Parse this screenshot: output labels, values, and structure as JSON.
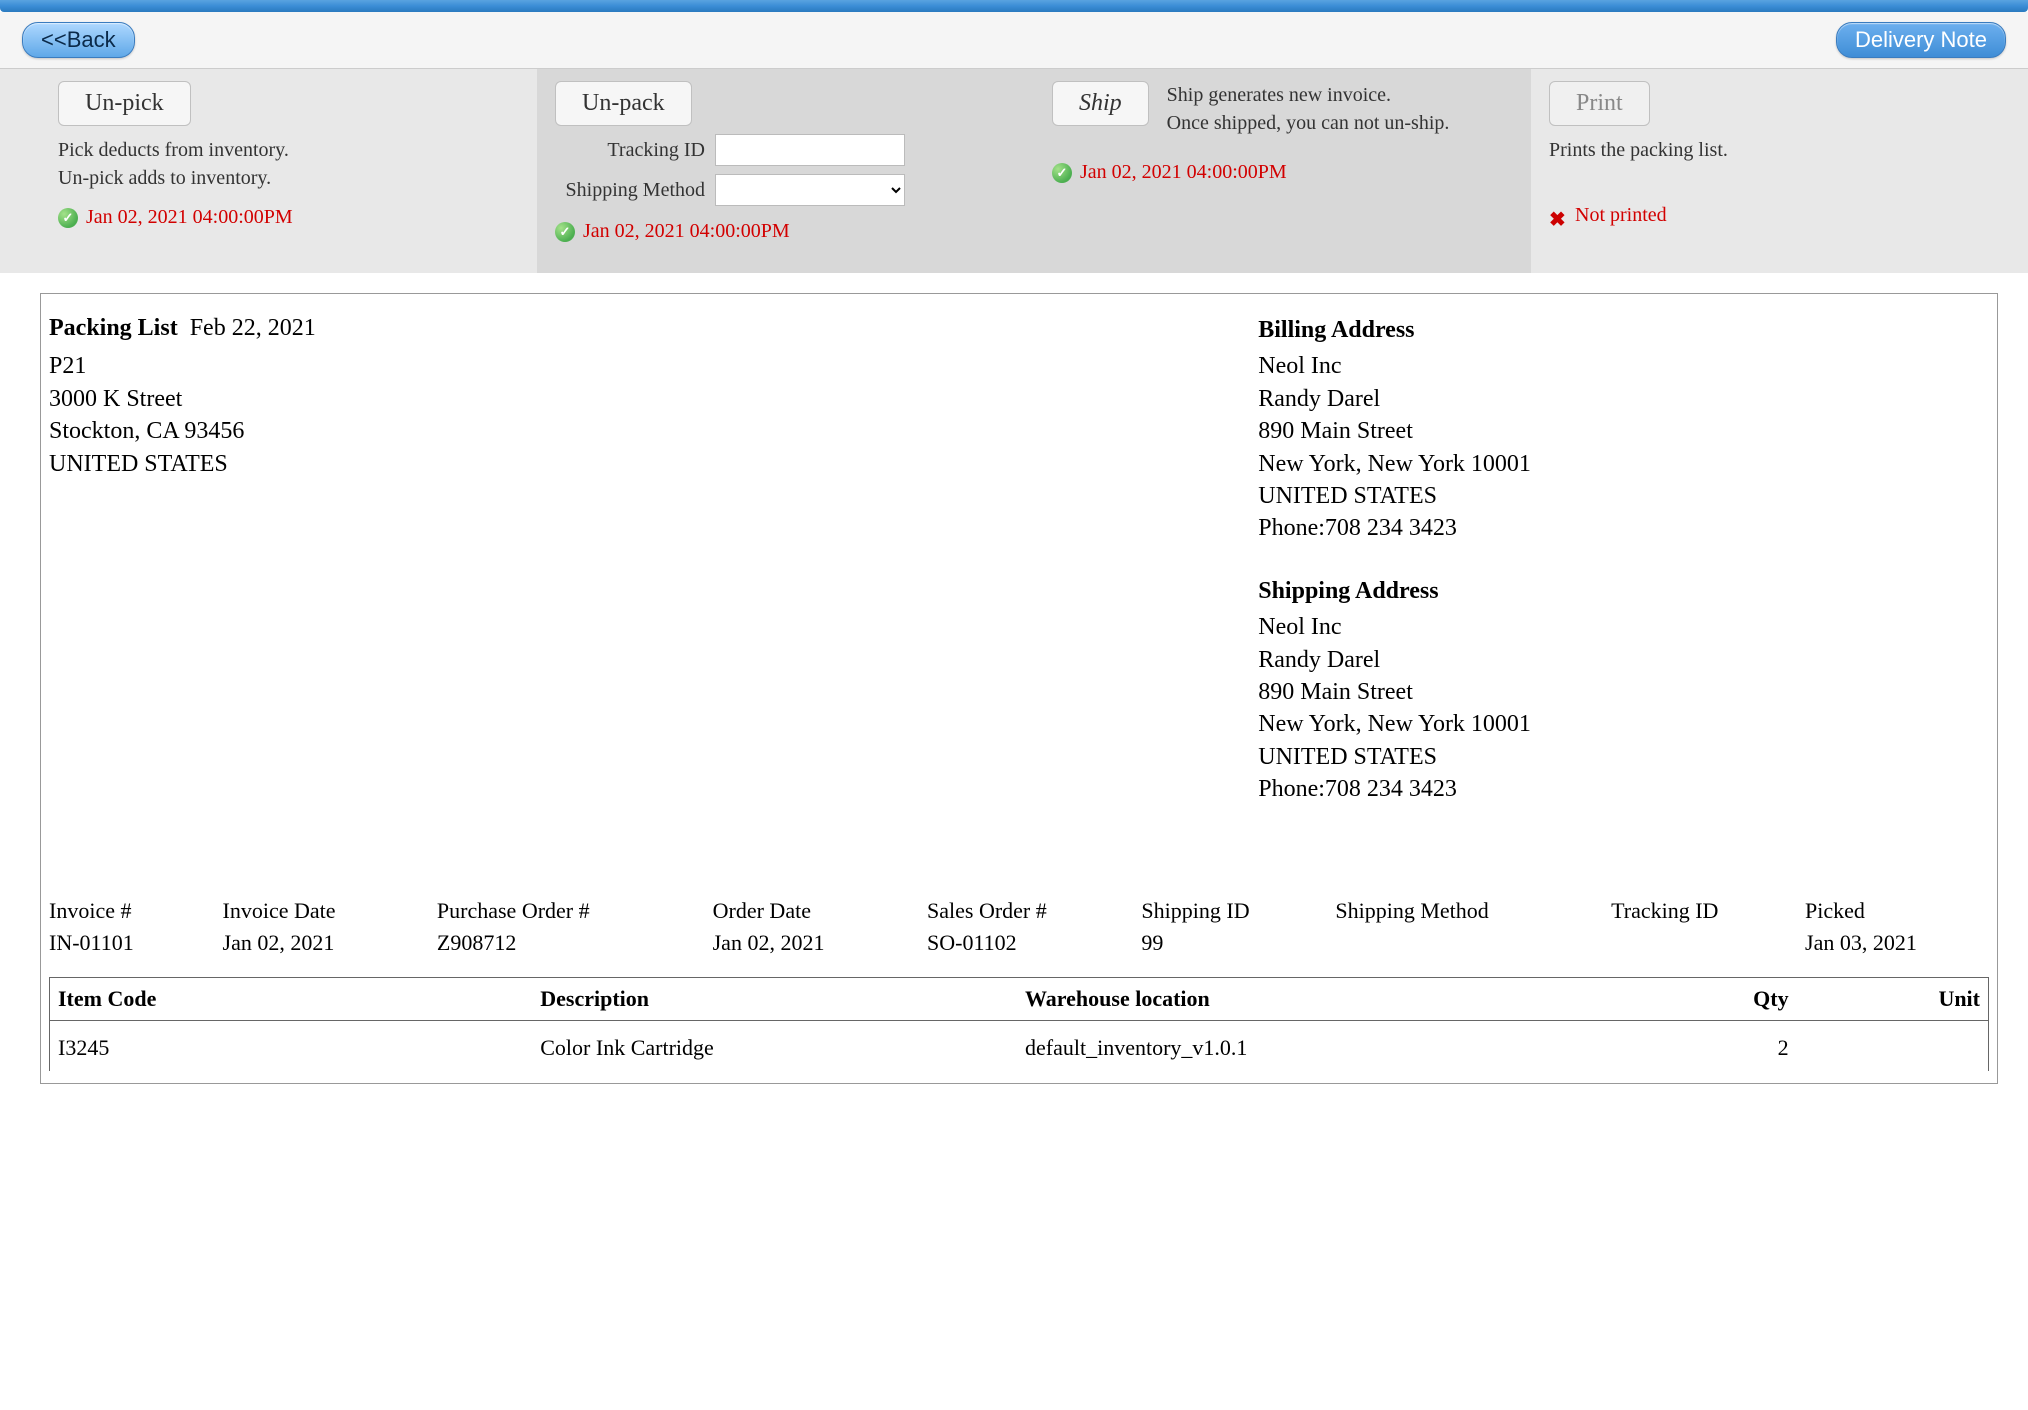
{
  "header": {
    "back_label": "<<Back",
    "delivery_note_label": "Delivery Note"
  },
  "actions": {
    "pick": {
      "button": "Un-pick",
      "help1": "Pick deducts from inventory.",
      "help2": "Un-pick adds to inventory.",
      "timestamp": "Jan 02, 2021 04:00:00PM"
    },
    "pack": {
      "button": "Un-pack",
      "tracking_label": "Tracking ID",
      "tracking_value": "",
      "shipmethod_label": "Shipping Method",
      "shipmethod_value": "",
      "timestamp": "Jan 02, 2021 04:00:00PM"
    },
    "ship": {
      "button": "Ship",
      "help1": "Ship generates new invoice.",
      "help2": "Once shipped, you can not un-ship.",
      "timestamp": "Jan 02, 2021 04:00:00PM"
    },
    "print": {
      "button": "Print",
      "help1": "Prints the packing list.",
      "status": "Not printed"
    }
  },
  "packing": {
    "title": "Packing List",
    "date": "Feb 22, 2021",
    "id": "P21",
    "from": {
      "street": "3000 K Street",
      "citystate": "Stockton, CA 93456",
      "country": "UNITED STATES"
    }
  },
  "billing": {
    "head": "Billing Address",
    "company": "Neol Inc",
    "name": "Randy Darel",
    "street": "890 Main Street",
    "citystate": "New York, New York 10001",
    "country": "UNITED STATES",
    "phone": "Phone:708 234 3423"
  },
  "shipping": {
    "head": "Shipping Address",
    "company": "Neol Inc",
    "name": "Randy Darel",
    "street": "890 Main Street",
    "citystate": "New York, New York 10001",
    "country": "UNITED STATES",
    "phone": "Phone:708 234 3423"
  },
  "meta": {
    "labels": {
      "invoice_no": "Invoice #",
      "invoice_date": "Invoice Date",
      "po_no": "Purchase Order #",
      "order_date": "Order Date",
      "so_no": "Sales Order #",
      "shipping_id": "Shipping ID",
      "shipping_method": "Shipping Method",
      "tracking_id": "Tracking ID",
      "picked": "Picked"
    },
    "values": {
      "invoice_no": "IN-01101",
      "invoice_date": "Jan 02, 2021",
      "po_no": "Z908712",
      "order_date": "Jan 02, 2021",
      "so_no": "SO-01102",
      "shipping_id": "99",
      "shipping_method": "",
      "tracking_id": "",
      "picked": "Jan 03, 2021"
    }
  },
  "items": {
    "headers": {
      "code": "Item Code",
      "desc": "Description",
      "loc": "Warehouse location",
      "qty": "Qty",
      "unit": "Unit"
    },
    "rows": [
      {
        "code": "I3245",
        "desc": "Color Ink Cartridge",
        "loc": "default_inventory_v1.0.1",
        "qty": "2",
        "unit": ""
      }
    ]
  }
}
